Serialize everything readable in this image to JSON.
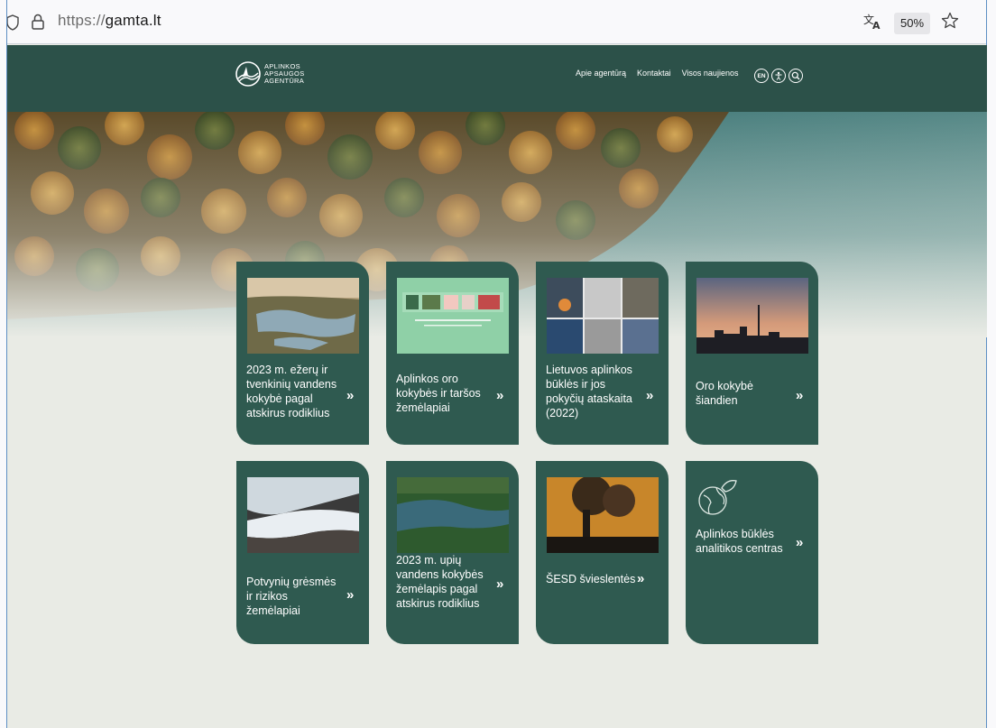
{
  "browser": {
    "url_scheme": "https://",
    "url_domain": "gamta.lt",
    "zoom": "50%"
  },
  "header": {
    "logo_lines": [
      "APLINKOS",
      "APSAUGOS",
      "AGENTŪRA"
    ],
    "nav": [
      "Apie agentūrą",
      "Kontaktai",
      "Visos naujienos"
    ],
    "lang_button": "EN"
  },
  "cards": [
    {
      "title": "2023 m. ežerų ir tvenkinių vandens kokybė pagal atskirus rodiklius",
      "arrow": "»"
    },
    {
      "title": "Aplinkos oro kokybės ir taršos žemėlapiai",
      "arrow": "»"
    },
    {
      "title": "Lietuvos aplinkos būklės ir jos pokyčių ataskaita (2022)",
      "arrow": "»"
    },
    {
      "title": "Oro kokybė šiandien",
      "arrow": "»"
    },
    {
      "title": "Potvynių grėsmės ir rizikos žemėlapiai",
      "arrow": "»"
    },
    {
      "title": "2023 m. upių vandens kokybės žemėlapis pagal atskirus rodiklius",
      "arrow": "»"
    },
    {
      "title": "ŠESD švieslentės",
      "arrow": "»"
    },
    {
      "title": "Aplinkos būklės analitikos centras",
      "arrow": "»"
    }
  ],
  "colors": {
    "header_bg": "#2c5149",
    "card_bg": "#2f5a50",
    "page_bg": "#e9ebe5"
  }
}
